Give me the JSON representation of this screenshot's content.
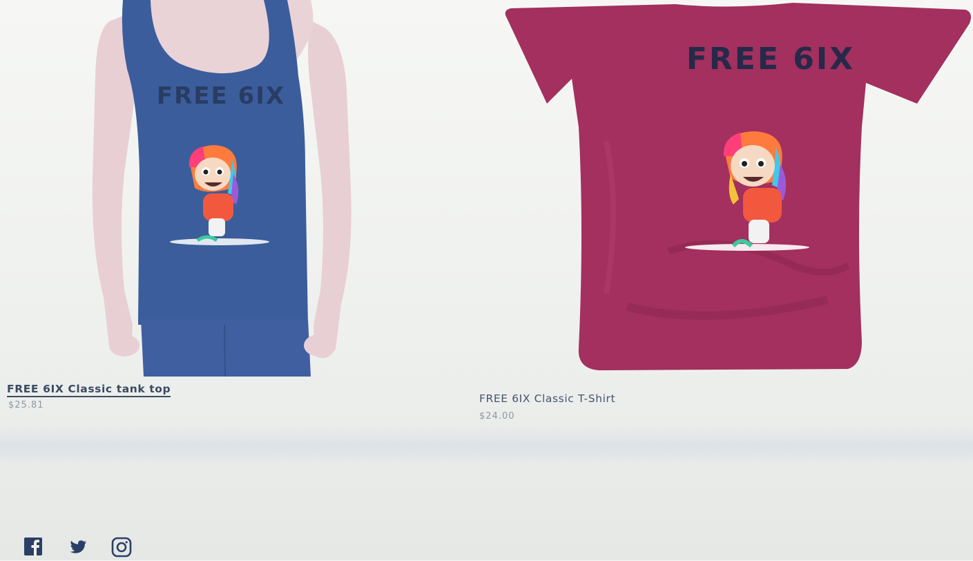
{
  "products": [
    {
      "title": "FREE 6IX Classic tank top",
      "price": "$25.81",
      "print_text": "FREE 6IX",
      "garment_color": "#3b5d9c"
    },
    {
      "title": "FREE 6IX Classic T-Shirt",
      "price": "$24.00",
      "print_text": "FREE 6IX",
      "garment_color": "#a3305e"
    }
  ],
  "social": {
    "icon_color": "#2b3f66",
    "links": [
      {
        "icon": "facebook-icon"
      },
      {
        "icon": "twitter-icon"
      },
      {
        "icon": "instagram-icon"
      }
    ]
  }
}
